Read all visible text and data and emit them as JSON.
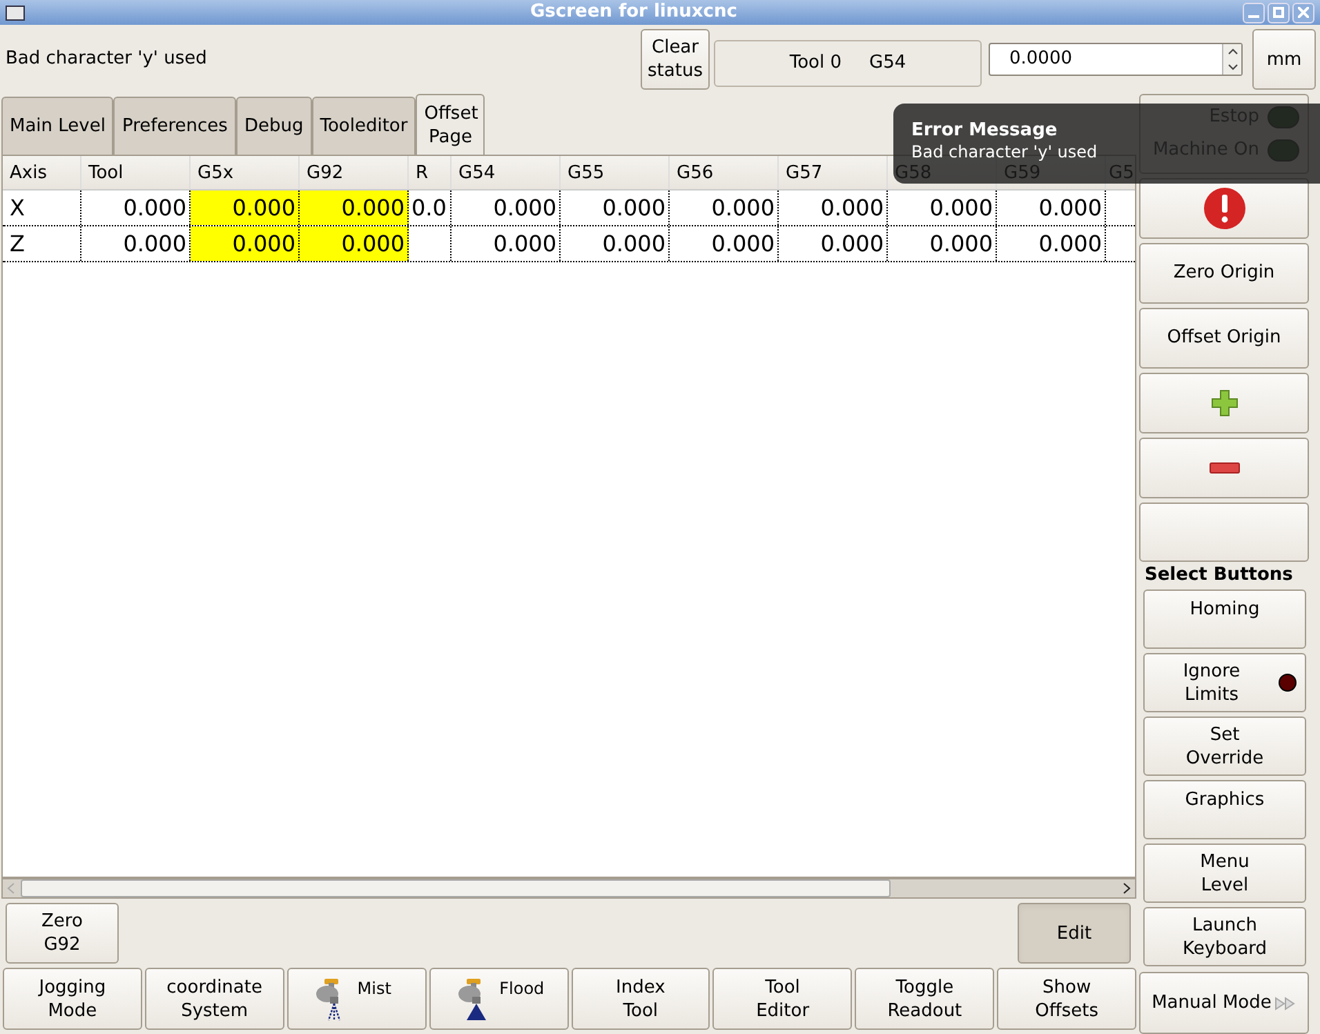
{
  "window": {
    "title": "Gscreen for linuxcnc"
  },
  "status": {
    "message": "Bad character 'y' used",
    "clear_button": "Clear status",
    "tool": "Tool 0",
    "system": "G54",
    "spin_value": "0.0000",
    "units_button": "mm"
  },
  "tabs": [
    {
      "label": "Main Level",
      "selected": false
    },
    {
      "label": "Preferences",
      "selected": false
    },
    {
      "label": "Debug",
      "selected": false
    },
    {
      "label": "Tooleditor",
      "selected": false
    },
    {
      "label": "Offset Page",
      "selected": true
    }
  ],
  "table": {
    "columns": [
      "Axis",
      "Tool",
      "G5x",
      "G92",
      "R",
      "G54",
      "G55",
      "G56",
      "G57",
      "G58",
      "G59",
      "G5"
    ],
    "rows": [
      {
        "cells": [
          {
            "text": "X",
            "highlighted": false
          },
          {
            "text": "0.000",
            "highlighted": false
          },
          {
            "text": "0.000",
            "highlighted": true
          },
          {
            "text": "0.000",
            "highlighted": true
          },
          {
            "text": "0.0",
            "highlighted": false
          },
          {
            "text": "0.000",
            "highlighted": false
          },
          {
            "text": "0.000",
            "highlighted": false
          },
          {
            "text": "0.000",
            "highlighted": false
          },
          {
            "text": "0.000",
            "highlighted": false
          },
          {
            "text": "0.000",
            "highlighted": false
          },
          {
            "text": "0.000",
            "highlighted": false
          }
        ]
      },
      {
        "cells": [
          {
            "text": "Z",
            "highlighted": false
          },
          {
            "text": "0.000",
            "highlighted": false
          },
          {
            "text": "0.000",
            "highlighted": true
          },
          {
            "text": "0.000",
            "highlighted": true
          },
          {
            "highlighted": false
          },
          {
            "text": "0.000",
            "highlighted": false
          },
          {
            "text": "0.000",
            "highlighted": false
          },
          {
            "text": "0.000",
            "highlighted": false
          },
          {
            "text": "0.000",
            "highlighted": false
          },
          {
            "text": "0.000",
            "highlighted": false
          },
          {
            "text": "0.000",
            "highlighted": false
          }
        ]
      }
    ]
  },
  "lower_buttons": [
    {
      "label": "Zero G92",
      "active": false
    },
    {
      "label": "Edit",
      "active": true
    }
  ],
  "bottom_buttons": [
    {
      "label": "Jogging Mode",
      "kind": "text"
    },
    {
      "label": "coordinate System",
      "kind": "text"
    },
    {
      "label": "Mist",
      "kind": "mist"
    },
    {
      "label": "Flood",
      "kind": "flood"
    },
    {
      "label": "Index Tool",
      "kind": "text"
    },
    {
      "label": "Tool Editor",
      "kind": "text"
    },
    {
      "label": "Toggle Readout",
      "kind": "text"
    },
    {
      "label": "Show Offsets",
      "kind": "text"
    }
  ],
  "indicators": [
    {
      "label": "Estop",
      "on": false
    },
    {
      "label": "Machine On",
      "on": false
    }
  ],
  "side_buttons": [
    {
      "kind": "error"
    },
    {
      "kind": "text",
      "label": "Zero Origin"
    },
    {
      "kind": "text",
      "label": "Offset Origin"
    },
    {
      "kind": "plus"
    },
    {
      "kind": "minus"
    },
    {
      "kind": "blank"
    }
  ],
  "select_label": "Select Buttons",
  "select_buttons": [
    {
      "label": "Homing",
      "kind": "text"
    },
    {
      "label": "Ignore Limits",
      "kind": "led",
      "on": false
    },
    {
      "label": "Set Override",
      "kind": "text"
    },
    {
      "label": "Graphics",
      "kind": "text"
    },
    {
      "label": "Menu Level",
      "kind": "text"
    },
    {
      "label": "Launch Keyboard",
      "kind": "text"
    }
  ],
  "mode_button": "Manual Mode",
  "error_popup": {
    "title": "Error Message",
    "message": "Bad character 'y' used"
  }
}
